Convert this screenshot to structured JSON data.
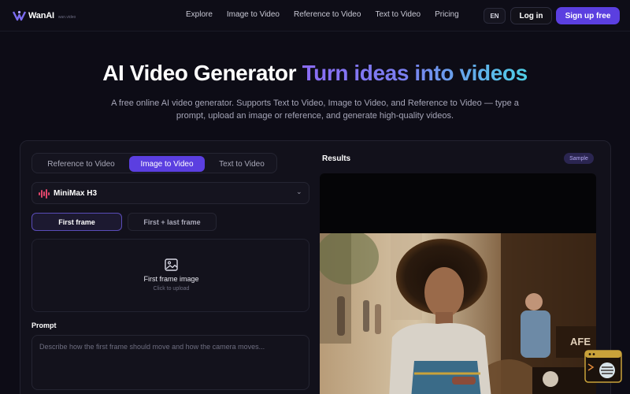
{
  "nav": {
    "logo_text": "WanAI",
    "logo_sub": "wan.video",
    "links": [
      "Explore",
      "Image to Video",
      "Reference to Video",
      "Text to Video",
      "Pricing"
    ],
    "language": "EN",
    "login_label": "Log in",
    "signup_label": "Sign up free"
  },
  "hero": {
    "title_main": "AI Video Generator",
    "title_accent": "Turn ideas into videos",
    "description": "A free online AI video generator. Supports Text to Video, Image to Video, and Reference to Video — type a prompt, upload an image or reference, and generate high-quality videos."
  },
  "generator": {
    "mode_tabs": [
      "Reference to Video",
      "Image to Video",
      "Text to Video"
    ],
    "active_mode": "Image to Video",
    "model": {
      "name": "MiniMax H3",
      "icon": "minimax-logo-icon"
    },
    "frame_options": [
      "First frame",
      "First + last frame"
    ],
    "active_frame_option": "First frame",
    "upload": {
      "label": "First frame image",
      "hint": "Click to upload",
      "icon": "image-icon"
    },
    "prompt": {
      "label": "Prompt",
      "value": "",
      "placeholder": "Describe how the first frame should move and how the camera moves..."
    }
  },
  "results": {
    "title": "Results",
    "badge": "Sample",
    "media": "sample-video"
  },
  "colors": {
    "background": "#0d0c16",
    "accent": "#5b3fe0",
    "gradient_start": "#8b6cf5",
    "gradient_end": "#4fd0e6",
    "text_muted": "#a6a6b8"
  }
}
